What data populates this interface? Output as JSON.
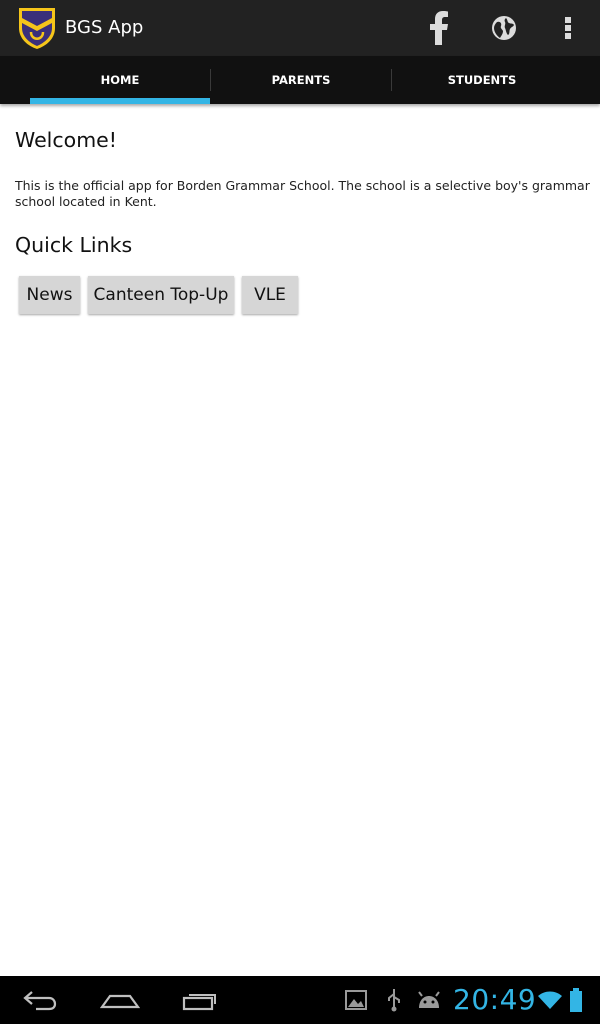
{
  "app": {
    "title": "BGS App"
  },
  "action_bar": {
    "icons": [
      "facebook-icon",
      "globe-icon",
      "overflow-menu-icon"
    ]
  },
  "tabs": [
    {
      "label": "HOME",
      "selected": true
    },
    {
      "label": "PARENTS",
      "selected": false
    },
    {
      "label": "STUDENTS",
      "selected": false
    }
  ],
  "main": {
    "welcome_heading": "Welcome!",
    "welcome_text": "This is the official app for Borden Grammar School. The school is a selective boy's grammar school located in Kent.",
    "quick_links_heading": "Quick Links",
    "quick_links": [
      "News",
      "Canteen Top-Up",
      "VLE"
    ]
  },
  "system_bar": {
    "time": "20:49",
    "nav_icons": [
      "back-icon",
      "home-icon",
      "recent-apps-icon"
    ],
    "status_icons": [
      "gallery-notification-icon",
      "usb-icon",
      "android-debug-icon",
      "wifi-icon",
      "battery-icon"
    ]
  },
  "colors": {
    "accent": "#33b5e5",
    "action_bar": "#222222",
    "tab_bar": "#111111",
    "button": "#d6d6d6"
  }
}
